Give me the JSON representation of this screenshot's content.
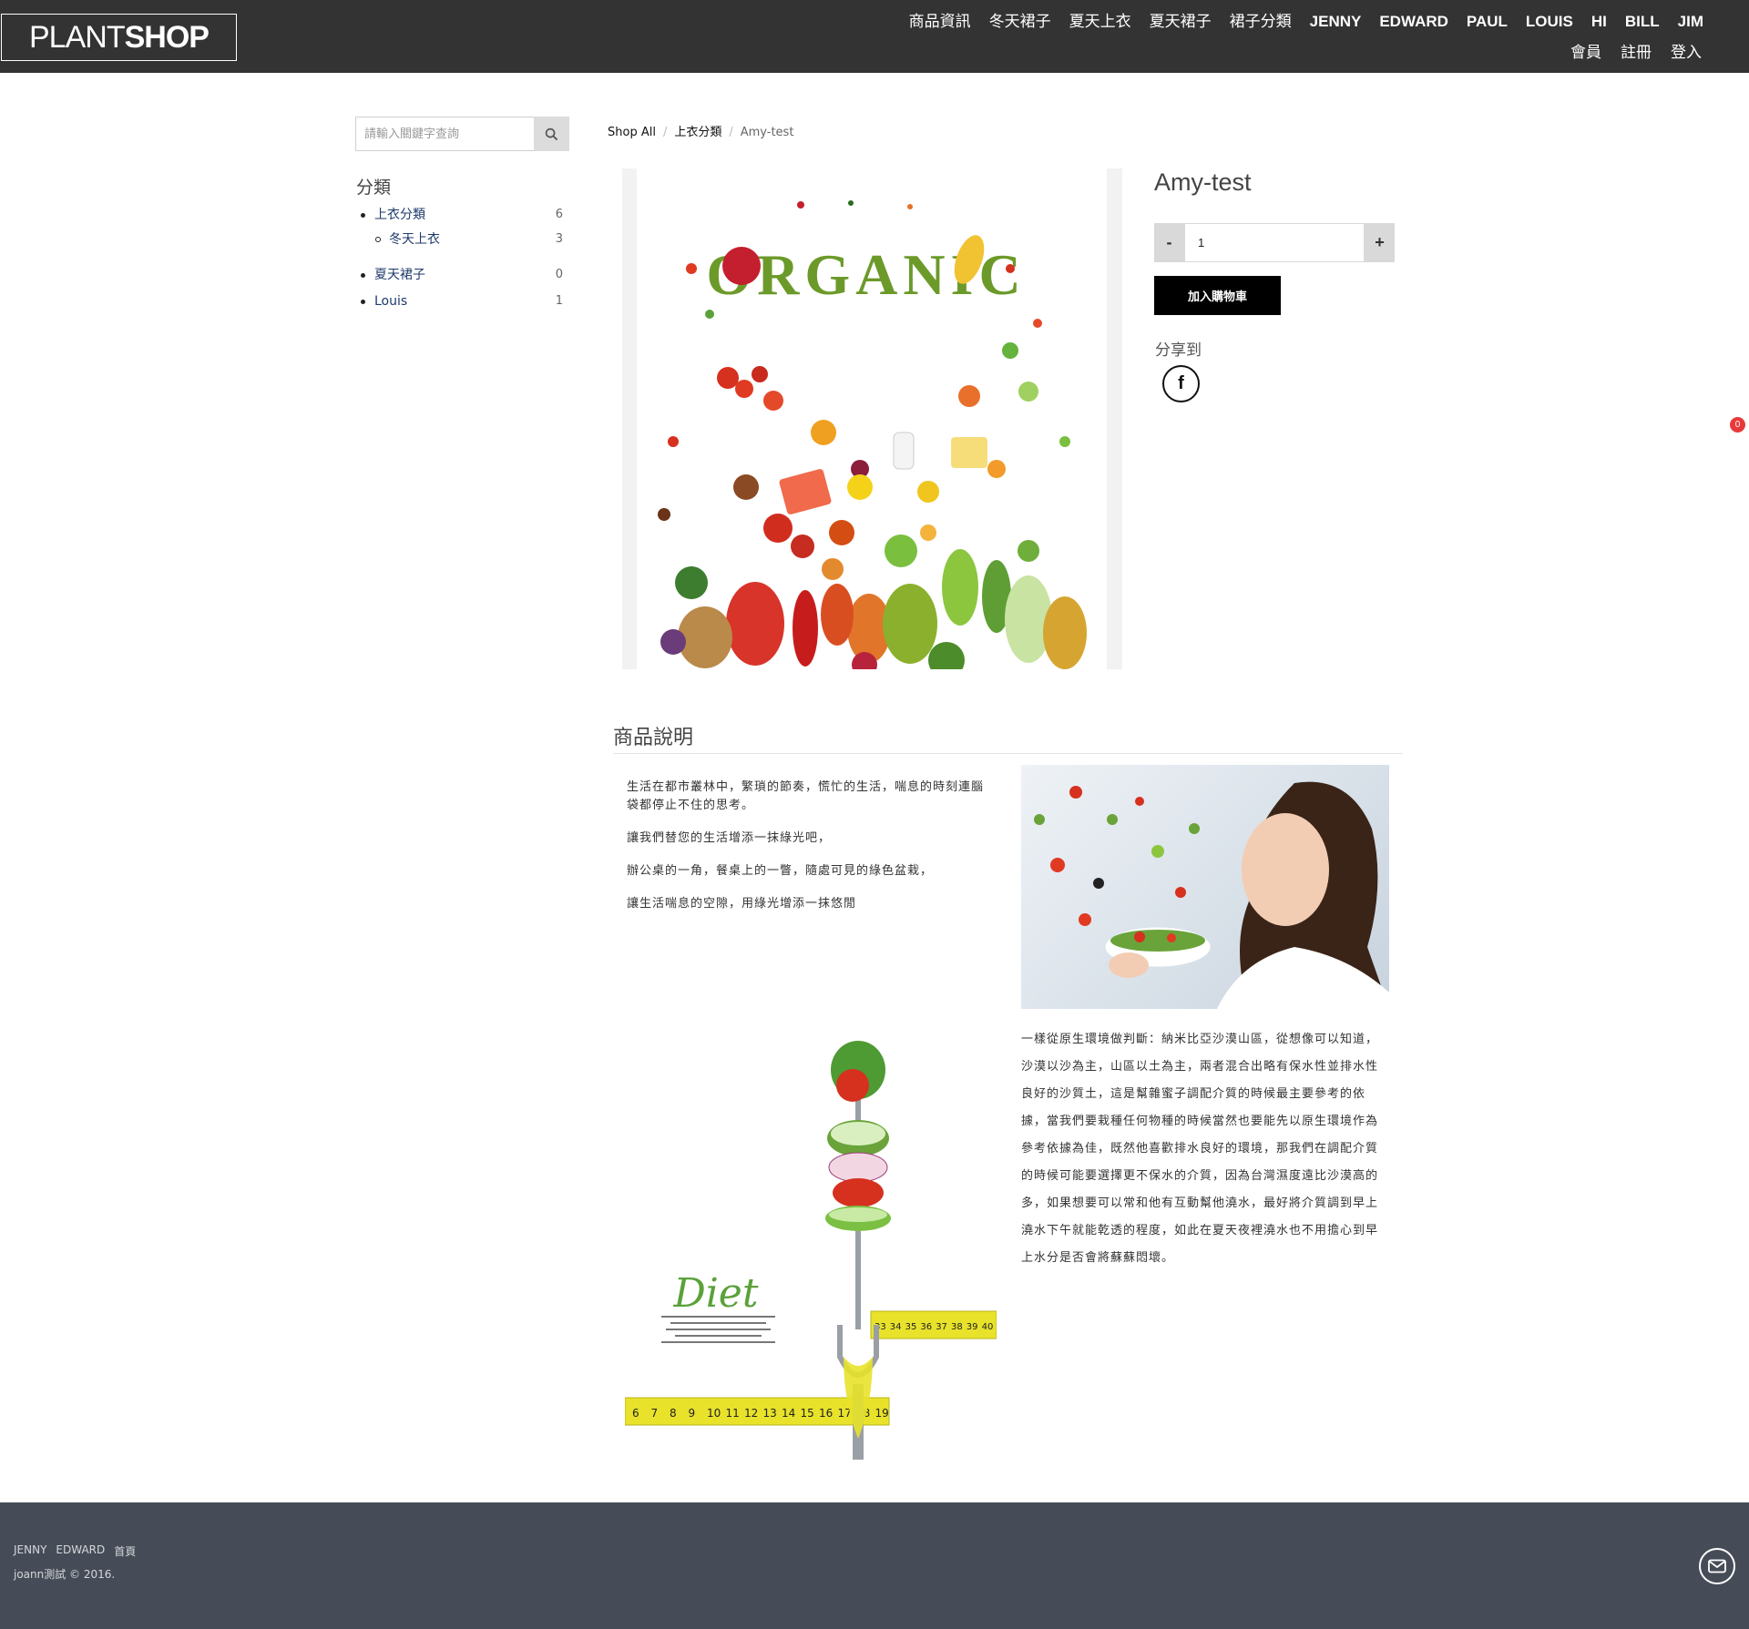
{
  "header": {
    "logo_light": "PLANT",
    "logo_bold": "SHOP",
    "nav_primary": [
      "商品資訊",
      "冬天裙子",
      "夏天上衣",
      "夏天裙子",
      "裙子分類",
      "JENNY",
      "EDWARD",
      "PAUL",
      "LOUIS",
      "HI",
      "BILL",
      "JIM"
    ],
    "nav_secondary": [
      "會員",
      "註冊",
      "登入"
    ]
  },
  "sidebar": {
    "search": {
      "placeholder": "請輸入關鍵字查詢"
    },
    "category_title": "分類",
    "categories": [
      {
        "label": "上衣分類",
        "count": "6"
      },
      {
        "label": "冬天上衣",
        "count": "3"
      },
      {
        "label": "夏天裙子",
        "count": "0"
      },
      {
        "label": "Louis",
        "count": "1"
      }
    ]
  },
  "breadcrumb": {
    "root": "Shop All",
    "category": "上衣分類",
    "current": "Amy-test"
  },
  "product": {
    "title": "Amy-test",
    "quantity": "1",
    "minus_label": "-",
    "plus_label": "+",
    "add_to_cart": "加入購物車",
    "share_title": "分享到",
    "facebook_glyph": "f",
    "image_wordmark": "ORGANIC"
  },
  "cart": {
    "count": "0"
  },
  "description": {
    "heading": "商品說明",
    "left_paragraphs": [
      "生活在都市叢林中，繁瑣的節奏，慌忙的生活，喘息的時刻連腦袋都停止不住的思考。",
      "讓我們替您的生活增添一抹綠光吧，",
      "辦公桌的一角，餐桌上的一瞥，隨處可見的綠色盆栽，",
      "讓生活喘息的空隙，用綠光增添一抹悠閒"
    ],
    "right_paragraph": "一樣從原生環境做判斷：納米比亞沙漠山區，從想像可以知道，沙漠以沙為主，山區以土為主，兩者混合出略有保水性並排水性良好的沙質土，這是幫雜蜜子調配介質的時候最主要參考的依據，當我們要栽種任何物種的時候當然也要能先以原生環境作為參考依據為佳，既然他喜歡排水良好的環境，那我們在調配介質的時候可能要選擇更不保水的介質，因為台灣濕度遠比沙漠高的多，如果想要可以常和他有互動幫他澆水，最好將介質調到早上澆水下午就能乾透的程度，如此在夏天夜裡澆水也不用擔心到早上水分是否會將蘇蘇悶壞。",
    "diet_word": "Diet",
    "tape_numbers": [
      "6",
      "7",
      "8",
      "9",
      "10",
      "11",
      "12",
      "13",
      "14",
      "15",
      "16",
      "17",
      "18",
      "19"
    ],
    "tape_numbers_upper": [
      "33",
      "34",
      "35",
      "36",
      "37",
      "38",
      "39",
      "40"
    ]
  },
  "footer": {
    "links": [
      "JENNY",
      "EDWARD",
      "首頁"
    ],
    "copyright": "joann測試 © 2016."
  },
  "colors": {
    "header_bg": "#333333",
    "footer_bg": "#464c57",
    "link": "#1e3a6b",
    "badge": "#e8393a",
    "button": "#000000"
  }
}
